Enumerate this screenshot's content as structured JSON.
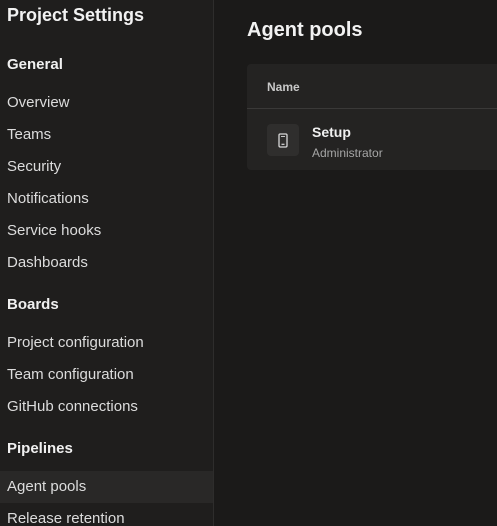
{
  "sidebar": {
    "title": "Project Settings",
    "sections": {
      "general": {
        "label": "General",
        "items": [
          "Overview",
          "Teams",
          "Security",
          "Notifications",
          "Service hooks",
          "Dashboards"
        ]
      },
      "boards": {
        "label": "Boards",
        "items": [
          "Project configuration",
          "Team configuration",
          "GitHub connections"
        ]
      },
      "pipelines": {
        "label": "Pipelines",
        "items": [
          "Agent pools",
          "Release retention"
        ],
        "selected": "Agent pools"
      }
    }
  },
  "main": {
    "title": "Agent pools",
    "table": {
      "columns": [
        "Name"
      ],
      "rows": [
        {
          "name": "Setup",
          "subtitle": "Administrator",
          "icon": "device-icon"
        }
      ]
    }
  },
  "colors": {
    "background": "#1b1a19",
    "sidebar": "#1f1e1d",
    "selected": "#292827",
    "card": "#242322"
  }
}
